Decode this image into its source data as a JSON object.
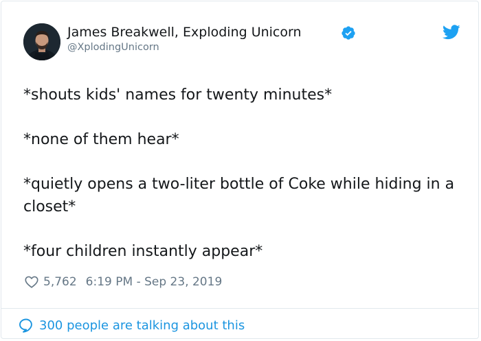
{
  "author": {
    "display_name": "James Breakwell, Exploding Unicorn",
    "handle": "@XplodingUnicorn",
    "verified": true,
    "avatar_icon": "user-avatar-photo"
  },
  "platform_icon": "twitter-bird-icon",
  "tweet": {
    "paragraphs": [
      "*shouts kids' names for twenty minutes*",
      "*none of them hear*",
      "*quietly opens a two-liter bottle of Coke while hiding in a closet*",
      "*four children instantly appear*"
    ]
  },
  "meta": {
    "like_count": "5,762",
    "timestamp": "6:19 PM - Sep 23, 2019"
  },
  "footer": {
    "talking_label": "300 people are talking about this"
  },
  "colors": {
    "brand_blue": "#1da1f2",
    "link_blue": "#1b95e0",
    "secondary_text": "#657786",
    "border": "#e1e8ed"
  }
}
